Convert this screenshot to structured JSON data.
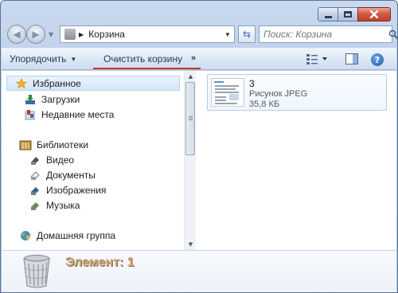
{
  "window": {
    "title": "Корзина"
  },
  "address_bar": {
    "location": "Корзина"
  },
  "search": {
    "placeholder": "Поиск: Корзина"
  },
  "toolbar": {
    "organize_label": "Упорядочить",
    "empty_bin_label": "Очистить корзину",
    "more_label": "»"
  },
  "navigation": {
    "favorites": {
      "label": "Избранное",
      "items": [
        "Загрузки",
        "Недавние места"
      ]
    },
    "libraries": {
      "label": "Библиотеки",
      "items": [
        "Видео",
        "Документы",
        "Изображения",
        "Музыка"
      ]
    },
    "homegroup": {
      "label": "Домашняя группа"
    }
  },
  "files": [
    {
      "name": "3",
      "type": "Рисунок JPEG",
      "size": "35,8 КБ"
    }
  ],
  "details": {
    "status": "Элемент: 1"
  },
  "colors": {
    "accent_underline": "#c0392b",
    "selection": "#d4e6fa"
  }
}
